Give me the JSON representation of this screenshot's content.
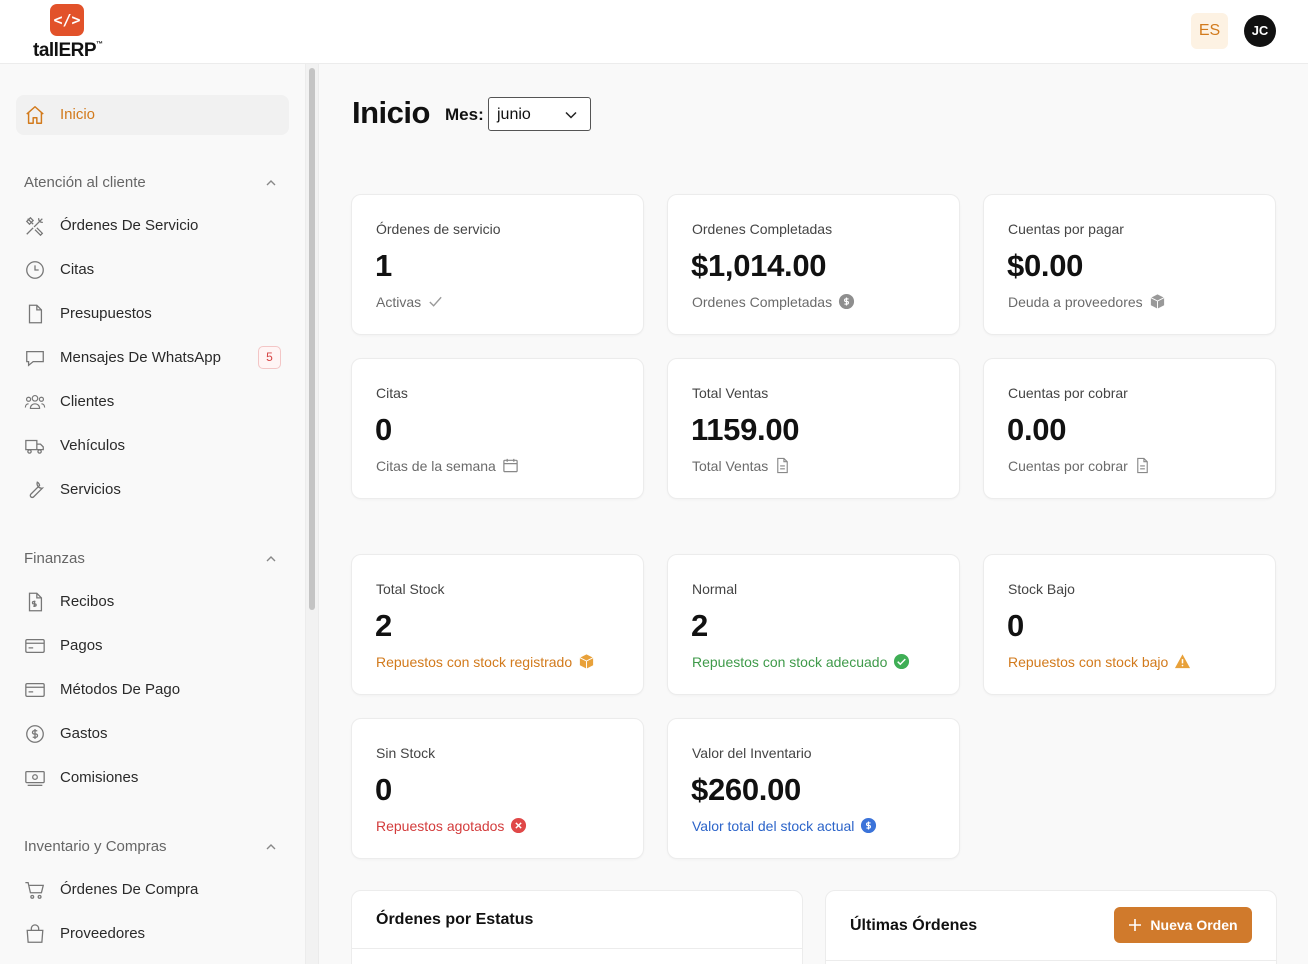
{
  "header": {
    "logo_glyph": "</>",
    "logo_text": "tallERP",
    "logo_tm": "™",
    "language": "ES",
    "user_initials": "JC"
  },
  "sidebar": {
    "home": {
      "label": "Inicio",
      "icon": "home-icon"
    },
    "sections": [
      {
        "title": "Atención al cliente",
        "items": [
          {
            "label": "Órdenes De Servicio",
            "icon": "tools-icon"
          },
          {
            "label": "Citas",
            "icon": "clock-icon"
          },
          {
            "label": "Presupuestos",
            "icon": "document-icon"
          },
          {
            "label": "Mensajes De WhatsApp",
            "icon": "chat-icon",
            "badge": "5"
          },
          {
            "label": "Clientes",
            "icon": "users-icon"
          },
          {
            "label": "Vehículos",
            "icon": "truck-icon"
          },
          {
            "label": "Servicios",
            "icon": "wrench-icon"
          }
        ]
      },
      {
        "title": "Finanzas",
        "items": [
          {
            "label": "Recibos",
            "icon": "receipt-icon"
          },
          {
            "label": "Pagos",
            "icon": "credit-card-icon"
          },
          {
            "label": "Métodos De Pago",
            "icon": "credit-card-icon"
          },
          {
            "label": "Gastos",
            "icon": "dollar-circle-icon"
          },
          {
            "label": "Comisiones",
            "icon": "cash-icon"
          }
        ]
      },
      {
        "title": "Inventario y Compras",
        "items": [
          {
            "label": "Órdenes De Compra",
            "icon": "cart-icon"
          },
          {
            "label": "Proveedores",
            "icon": "bag-icon"
          }
        ]
      }
    ]
  },
  "main": {
    "title": "Inicio",
    "month_label": "Mes:",
    "month_value": "junio",
    "cards": [
      {
        "title": "Órdenes de servicio",
        "value": "1",
        "sub": "Activas",
        "icon": "check-icon"
      },
      {
        "title": "Ordenes Completadas",
        "value": "$1,014.00",
        "sub": "Ordenes Completadas",
        "icon": "dollar-circle-icon"
      },
      {
        "title": "Cuentas por pagar",
        "value": "$0.00",
        "sub": "Deuda a proveedores",
        "icon": "cube-icon"
      },
      {
        "title": "Citas",
        "value": "0",
        "sub": "Citas de la semana",
        "icon": "calendar-icon"
      },
      {
        "title": "Total Ventas",
        "value": "1159.00",
        "sub": "Total Ventas",
        "icon": "document-icon"
      },
      {
        "title": "Cuentas por cobrar",
        "value": "0.00",
        "sub": "Cuentas por cobrar",
        "icon": "document-icon"
      },
      {
        "title": "Total Stock",
        "value": "2",
        "sub": "Repuestos con stock registrado",
        "icon": "cube-icon",
        "tone": "#d27a1c"
      },
      {
        "title": "Normal",
        "value": "2",
        "sub": "Repuestos con stock adecuado",
        "icon": "check-circle-icon",
        "tone": "#3f9a4a"
      },
      {
        "title": "Stock Bajo",
        "value": "0",
        "sub": "Repuestos con stock bajo",
        "icon": "warning-icon",
        "tone": "#d27a1c"
      },
      {
        "title": "Sin Stock",
        "value": "0",
        "sub": "Repuestos agotados",
        "icon": "x-circle-icon",
        "tone": "#d33c3c"
      },
      {
        "title": "Valor del Inventario",
        "value": "$260.00",
        "sub": "Valor total del stock actual",
        "icon": "dollar-circle-icon",
        "tone": "#2c64c9"
      }
    ],
    "orders_by_status": {
      "title": "Órdenes por Estatus"
    },
    "latest_orders": {
      "title": "Últimas Órdenes",
      "new_button": "Nueva Orden"
    }
  },
  "colors": {
    "accent": "#d07a2c",
    "logo": "#e2522a",
    "success": "#3f9a4a",
    "danger": "#d33c3c",
    "info": "#2c64c9"
  }
}
